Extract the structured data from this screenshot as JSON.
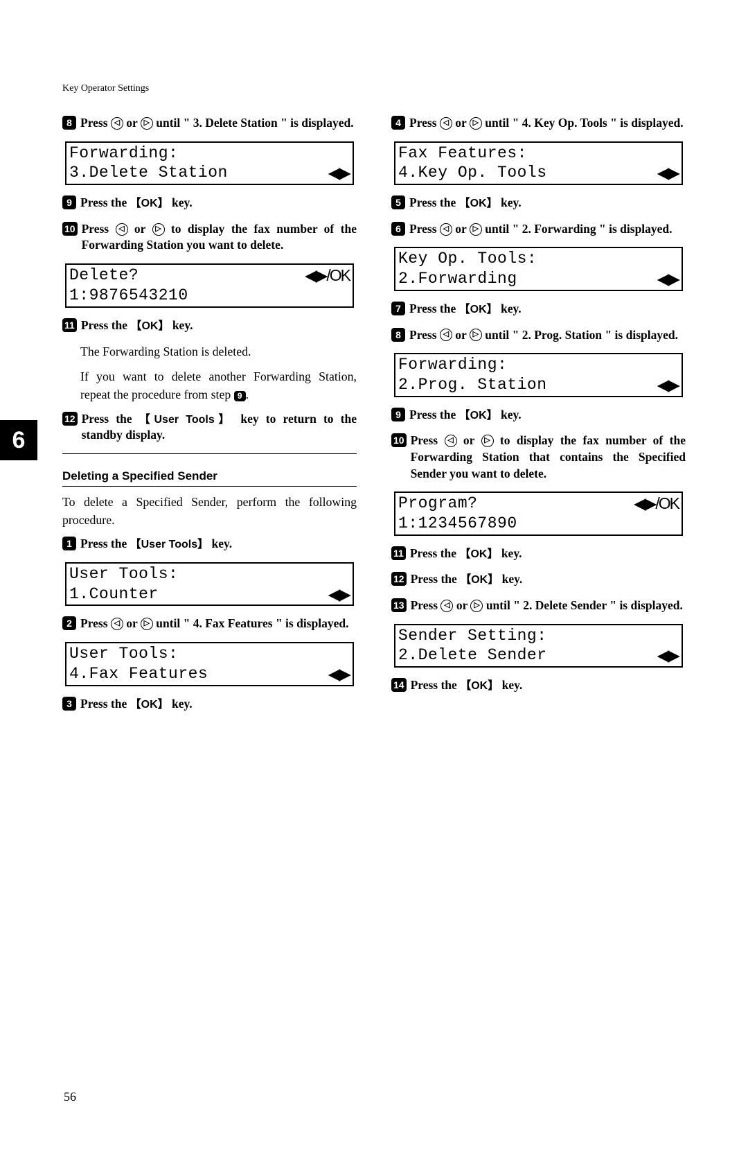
{
  "header": "Key Operator Settings",
  "chapter_tab": "6",
  "page_number": "56",
  "left": {
    "step8": {
      "num": "8",
      "text_a": "Press ",
      "text_b": " or ",
      "text_c": " until \" 3. Delete Station \" is displayed."
    },
    "lcd1": {
      "line1": "Forwarding:",
      "line2": "3.Delete Station",
      "line2_right": "◀▶"
    },
    "step9": {
      "num": "9",
      "text_a": "Press the ",
      "key": "OK",
      "text_b": " key."
    },
    "step10": {
      "num": "10",
      "text_a": "Press ",
      "text_b": " or ",
      "text_c": " to display the fax number of the Forwarding Station you want to delete."
    },
    "lcd2": {
      "line1": "Delete?",
      "line1_right": "◀▶/OK",
      "line2": "1:9876543210"
    },
    "step11": {
      "num": "11",
      "text_a": "Press the ",
      "key": "OK",
      "text_b": " key."
    },
    "body1": "The Forwarding Station is deleted.",
    "body2_a": "If you want to delete another Forwarding Station, repeat the procedure from step ",
    "body2_badge": "9",
    "body2_b": ".",
    "step12": {
      "num": "12",
      "text_a": "Press the ",
      "key": "User Tools",
      "text_b": " key to return to the standby display."
    },
    "subhead": "Deleting a Specified Sender",
    "intro": "To delete a Specified Sender, perform the following procedure.",
    "b_step1": {
      "num": "1",
      "text_a": "Press the ",
      "key": "User Tools",
      "text_b": " key."
    },
    "lcd3": {
      "line1": "User Tools:",
      "line2": "1.Counter",
      "line2_right": "◀▶"
    },
    "b_step2": {
      "num": "2",
      "text_a": "Press ",
      "text_b": " or ",
      "text_c": " until \" 4. Fax Features \" is displayed."
    },
    "lcd4": {
      "line1": "User Tools:",
      "line2": "4.Fax Features",
      "line2_right": "◀▶"
    },
    "b_step3": {
      "num": "3",
      "text_a": "Press the ",
      "key": "OK",
      "text_b": " key."
    }
  },
  "right": {
    "step4": {
      "num": "4",
      "text_a": "Press ",
      "text_b": " or ",
      "text_c": " until \" 4. Key Op. Tools \" is displayed."
    },
    "lcd5": {
      "line1": "Fax Features:",
      "line2": "4.Key Op. Tools",
      "line2_right": "◀▶"
    },
    "step5": {
      "num": "5",
      "text_a": "Press the ",
      "key": "OK",
      "text_b": " key."
    },
    "step6": {
      "num": "6",
      "text_a": "Press ",
      "text_b": " or ",
      "text_c": " until \" 2. Forwarding \" is displayed."
    },
    "lcd6": {
      "line1": "Key Op. Tools:",
      "line2": "2.Forwarding",
      "line2_right": "◀▶"
    },
    "step7": {
      "num": "7",
      "text_a": "Press the ",
      "key": "OK",
      "text_b": " key."
    },
    "step8": {
      "num": "8",
      "text_a": "Press ",
      "text_b": " or ",
      "text_c": " until \" 2. Prog. Station \" is displayed."
    },
    "lcd7": {
      "line1": "Forwarding:",
      "line2": "2.Prog. Station",
      "line2_right": "◀▶"
    },
    "step9": {
      "num": "9",
      "text_a": "Press the ",
      "key": "OK",
      "text_b": " key."
    },
    "step10": {
      "num": "10",
      "text_a": "Press ",
      "text_b": " or ",
      "text_c": " to display the fax number of the Forwarding Station that contains the Specified Sender you want to delete."
    },
    "lcd8": {
      "line1": "Program?",
      "line1_right": "◀▶/OK",
      "line2": "1:1234567890"
    },
    "step11": {
      "num": "11",
      "text_a": "Press the ",
      "key": "OK",
      "text_b": " key."
    },
    "step12": {
      "num": "12",
      "text_a": "Press the ",
      "key": "OK",
      "text_b": " key."
    },
    "step13": {
      "num": "13",
      "text_a": "Press ",
      "text_b": " or ",
      "text_c": " until \" 2. Delete Sender \" is displayed."
    },
    "lcd9": {
      "line1": "Sender Setting:",
      "line2": "2.Delete Sender",
      "line2_right": "◀▶"
    },
    "step14": {
      "num": "14",
      "text_a": "Press the ",
      "key": "OK",
      "text_b": " key."
    }
  },
  "arrows": {
    "left": "◁",
    "right": "▷"
  }
}
